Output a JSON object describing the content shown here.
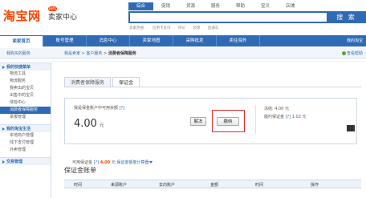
{
  "header": {
    "logo_main": "淘宝网",
    "logo_badge": "beta",
    "logo_sub": "卖家中心",
    "search_tabs": [
      "综合",
      "促销",
      "货源",
      "服务",
      "帮助",
      "宝贝",
      "店铺"
    ],
    "search_button": "搜 索",
    "hot_label": "卖家热搜:",
    "hot_terms": [
      "信用卡支付",
      "评价",
      "装修",
      "直通车"
    ]
  },
  "nav": {
    "items": [
      "卖家首页",
      "账号管理",
      "消息中心",
      "卖家地图",
      "采购批发",
      "卖往海外"
    ],
    "right_link": "我的淘宝"
  },
  "breadcrumb": {
    "left_link": "我购买的服务",
    "home": "我是卖家",
    "sep": ">",
    "parent": "客户服务",
    "current": "消费者保障服务",
    "right_link": "查看帮助"
  },
  "sidebar": {
    "sections": [
      {
        "title": "我的快捷菜单",
        "items": [
          "物流工具",
          "物流服务",
          "我卖出的宝贝",
          "出售中的宝贝",
          "体检中心",
          "消费者保障服务",
          "举报管理"
        ]
      },
      {
        "title": "我的淘宝生活",
        "items": [
          "本地商户管理",
          "线下支付管理",
          "外卖管理"
        ]
      },
      {
        "title": "交易管理",
        "items": []
      }
    ]
  },
  "tabs": [
    "消费者保障服务",
    "保证金"
  ],
  "deposit": {
    "label": "我是保金账户中可用余额",
    "help": "[?]",
    "amount": "4.00",
    "unit": "元",
    "release_button": "解冻",
    "pay_button": "缴纳",
    "frozen_label": "冻结:",
    "frozen_value": "4.00 元",
    "required_label": "履约保证金",
    "required_help": "[?]",
    "required_value": "1.02 元"
  },
  "available": {
    "label": "可用保证金",
    "help": "[?]",
    "value": "4.00",
    "unit": "元",
    "link": "保证金额度计算器"
  },
  "section_title": "保证金账单",
  "table_headers": [
    "时间",
    "来源账户",
    "去向账户",
    "金额",
    "时间",
    "操作"
  ]
}
